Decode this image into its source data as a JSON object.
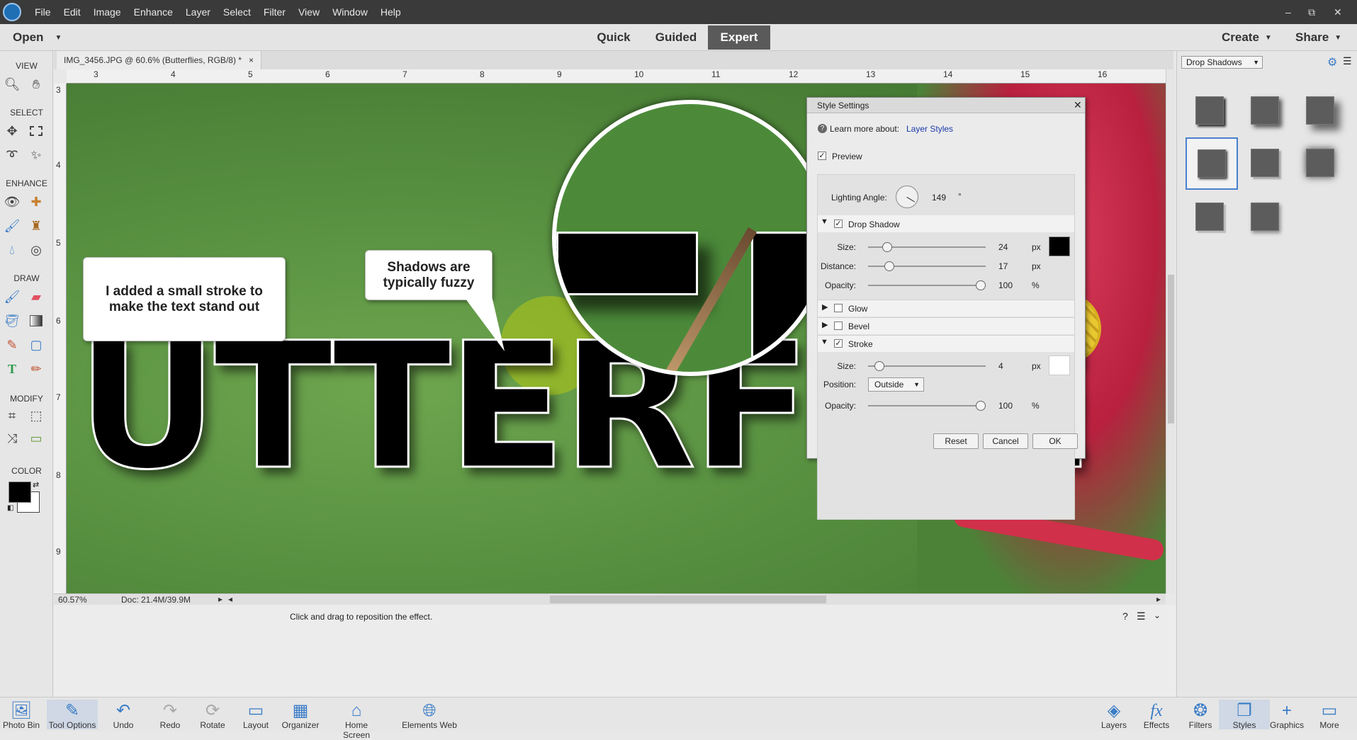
{
  "menubar": {
    "items": [
      "File",
      "Edit",
      "Image",
      "Enhance",
      "Layer",
      "Select",
      "Filter",
      "View",
      "Window",
      "Help"
    ],
    "window_controls": [
      "–",
      "⧉",
      "✕"
    ]
  },
  "modebar": {
    "open_label": "Open",
    "modes": [
      "Quick",
      "Guided",
      "Expert"
    ],
    "active_mode": "Expert",
    "create_label": "Create",
    "share_label": "Share"
  },
  "toolbox": {
    "sections": [
      "VIEW",
      "SELECT",
      "ENHANCE",
      "DRAW",
      "MODIFY",
      "COLOR"
    ],
    "foreground_color": "#000000",
    "background_color": "#ffffff"
  },
  "document": {
    "tab_title": "IMG_3456.JPG @ 60.6% (Butterflies, RGB/8) *",
    "tab_close": "×",
    "ruler_top": [
      "3",
      "4",
      "5",
      "6",
      "7",
      "8",
      "9",
      "10",
      "11",
      "12",
      "13",
      "14",
      "15",
      "16"
    ],
    "ruler_left": [
      "3",
      "4",
      "5",
      "6",
      "7",
      "8",
      "9"
    ],
    "canvas_text": "UTTERFLIE",
    "callout_left": "I added a small stroke to make the text stand out",
    "callout_right": "Shadows are typically fuzzy",
    "zoom": "60.57%",
    "doc_size": "Doc: 21.4M/39.9M",
    "hint": "Click and drag to reposition the effect."
  },
  "dialog": {
    "title": "Style Settings",
    "learn_more_prefix": "Learn more about:",
    "learn_more_link": "Layer Styles",
    "preview_label": "Preview",
    "preview_checked": true,
    "lighting_angle_label": "Lighting Angle:",
    "lighting_angle_value": "149",
    "degree_symbol": "°",
    "drop_shadow": {
      "label": "Drop Shadow",
      "checked": true,
      "size_label": "Size:",
      "size_value": "24",
      "size_unit": "px",
      "size_slider": 0.13,
      "distance_label": "Distance:",
      "distance_value": "17",
      "distance_unit": "px",
      "distance_slider": 0.15,
      "opacity_label": "Opacity:",
      "opacity_value": "100",
      "opacity_unit": "%",
      "opacity_slider": 1.0,
      "color": "#000000"
    },
    "glow_label": "Glow",
    "bevel_label": "Bevel",
    "stroke": {
      "label": "Stroke",
      "checked": true,
      "size_label": "Size:",
      "size_value": "4",
      "size_unit": "px",
      "size_slider": 0.06,
      "position_label": "Position:",
      "position_value": "Outside",
      "opacity_label": "Opacity:",
      "opacity_value": "100",
      "opacity_unit": "%",
      "opacity_slider": 1.0,
      "color": "#ffffff"
    },
    "reset_label": "Reset",
    "cancel_label": "Cancel",
    "ok_label": "OK"
  },
  "styles_panel": {
    "dropdown_value": "Drop Shadows"
  },
  "taskbar": {
    "left": [
      "Photo Bin",
      "Tool Options",
      "Undo",
      "Redo",
      "Rotate",
      "Layout",
      "Organizer",
      "Home Screen",
      "Elements Web"
    ],
    "right": [
      "Layers",
      "Effects",
      "Filters",
      "Styles",
      "Graphics",
      "More"
    ]
  }
}
